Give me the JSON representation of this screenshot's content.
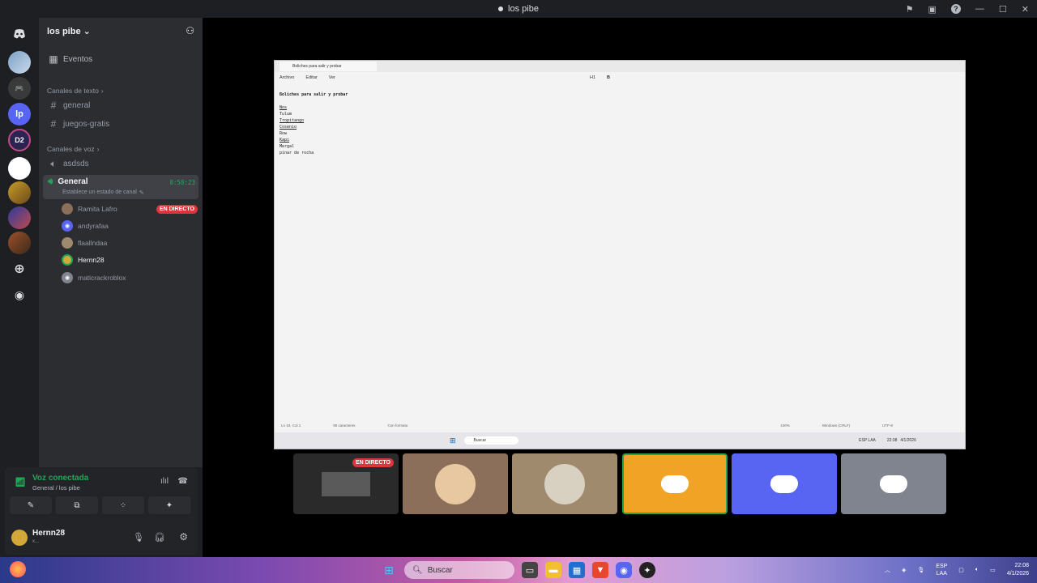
{
  "window": {
    "title": "los pibe"
  },
  "server": {
    "name": "los pibe"
  },
  "sidebar": {
    "events": "Eventos",
    "text_category": "Canales de texto",
    "text_channels": [
      "general",
      "juegos-gratis"
    ],
    "voice_category": "Canales de voz",
    "voice_channels": [
      {
        "name": "asdsds"
      },
      {
        "name": "General",
        "timer": "8:58:23",
        "status": "Establece un estado de canal"
      }
    ],
    "voice_users": [
      {
        "name": "Ramita Lafro",
        "badge": "EN DIRECTO"
      },
      {
        "name": "andyrafaa"
      },
      {
        "name": "flaallndaa"
      },
      {
        "name": "Hernn28"
      },
      {
        "name": "maticrackroblox"
      }
    ]
  },
  "guild_labels": {
    "lp": "lp",
    "dz": "D2"
  },
  "voice_panel": {
    "status": "Voz conectada",
    "channel": "General / los pibe"
  },
  "user_panel": {
    "name": "Hernn28",
    "sub": "x..."
  },
  "stream_window": {
    "tab": "Boliches para salir y probar",
    "menu": [
      "Archivo",
      "Editar",
      "Ver"
    ],
    "toolbar_heading": "H1",
    "doc_title": "Boliches para salir y probar",
    "doc_lines": [
      "Nos",
      "Tulum",
      "Tropitango",
      "Cosenio",
      "Row",
      "Kapi",
      "Mergal",
      "pinar de rocha"
    ],
    "status": [
      "Ln 10, Col 1",
      "90 caracteres",
      "Con formato",
      "100%",
      "Windows (CRLF)",
      "UTF-8"
    ],
    "taskbar_search": "Buscar",
    "tray_lang": "ESP LAA",
    "clock_time": "22:08",
    "clock_date": "4/1/2026"
  },
  "tiles": [
    {
      "type": "screen",
      "badge": "EN DIRECTO",
      "color": "#2a2a2a"
    },
    {
      "type": "avatar",
      "color": "#8b6f5a"
    },
    {
      "type": "avatar",
      "color": "#a08a6e"
    },
    {
      "type": "discord",
      "color": "#f0a324"
    },
    {
      "type": "discord",
      "color": "#5865f2"
    },
    {
      "type": "discord",
      "color": "#80848e"
    }
  ],
  "taskbar": {
    "search": "Buscar",
    "lang": "ESP\nLAA",
    "time": "22:08",
    "date": "4/1/2026"
  },
  "colors": {
    "accent": "#5865f2",
    "live": "#da373c",
    "green": "#23a559",
    "highlight": "#f0a324"
  }
}
